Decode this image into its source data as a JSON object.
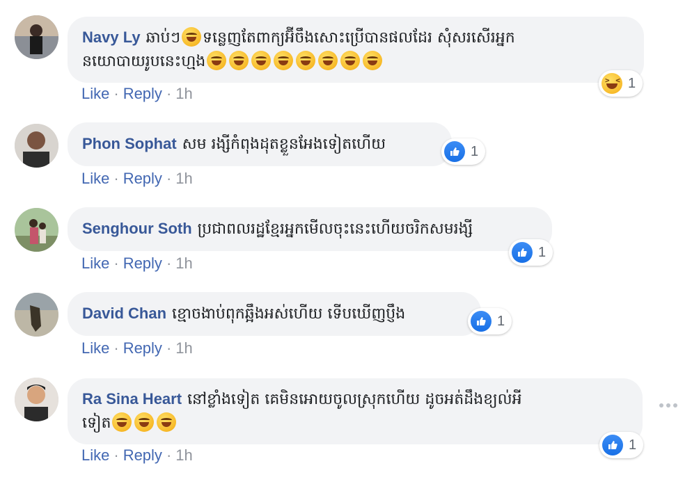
{
  "comments": [
    {
      "author": "Navy Ly",
      "line1": "ឆាប់ៗ",
      "line1b": "ទន្លេញតែពាក្យអ៊ីចឹងសោះប្រើបានផលដែរ សុំសរសើរអ្នក",
      "line2": "នយោបាយរូបនេះហ្មង",
      "like": "Like",
      "reply": "Reply",
      "time": "1h",
      "reaction_count": "1",
      "reaction_type": "haha"
    },
    {
      "author": "Phon Sophat",
      "text": "សម រង្សីកំពុងដុតខ្លួនអែងទៀតហើយ",
      "like": "Like",
      "reply": "Reply",
      "time": "1h",
      "reaction_count": "1",
      "reaction_type": "like"
    },
    {
      "author": "Senghour Soth",
      "text": "ប្រជាពលរដ្ឋខ្មែរអ្នកមើលចុះនេះហើយចរិកសមរង្សី",
      "like": "Like",
      "reply": "Reply",
      "time": "1h",
      "reaction_count": "1",
      "reaction_type": "like"
    },
    {
      "author": "David Chan",
      "text": "ខ្មោចងាប់ពុកឆ្អឹងអស់ហើយ ទើបឃើញប្ញឹង",
      "like": "Like",
      "reply": "Reply",
      "time": "1h",
      "reaction_count": "1",
      "reaction_type": "like"
    },
    {
      "author": "Ra Sina Heart",
      "line1": "នៅខ្លាំងទៀត គេមិនអោយចូលស្រុកហើយ ដូចអត់ដឹងខ្យល់អី",
      "line2": "ទៀត",
      "like": "Like",
      "reply": "Reply",
      "time": "1h",
      "reaction_count": "1",
      "reaction_type": "like"
    }
  ],
  "icons": {
    "like": "thumbs-up-icon",
    "haha": "laughing-face-icon",
    "emoji": "tears-of-joy-emoji",
    "more": "more-options-icon"
  },
  "colors": {
    "author": "#385898",
    "link": "#4267b2",
    "meta": "#90949c",
    "bubble": "#f2f3f5",
    "like_badge": "#1870e6"
  }
}
